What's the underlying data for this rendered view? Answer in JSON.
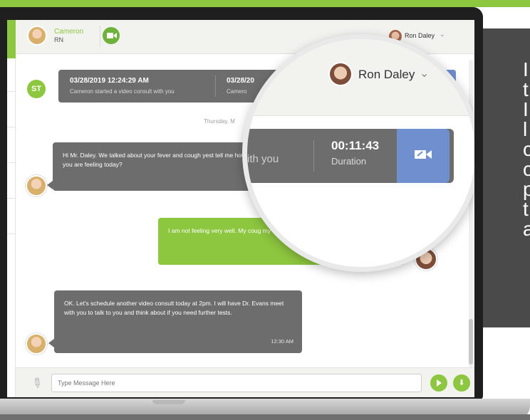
{
  "header": {
    "nurse_name": "Cameron",
    "nurse_role": "RN",
    "patient_name": "Ron Daley",
    "chevron": "⌄"
  },
  "event": {
    "badge": "ST",
    "timestamp": "03/28/2019 12:24:29 AM",
    "description": "Cameron started a video consult with you",
    "timestamp_partial": "03/28/20",
    "description_partial": "Camero"
  },
  "day_label": "Thursday, M",
  "messages": [
    {
      "from": "nurse",
      "text": "Hi Mr. Daley. We talked about your fever and cough yest tell me how you are feeling today?",
      "time": ""
    },
    {
      "from": "patient",
      "text": "I am not feeling very well. My coug my appetite is gone, I have a bit of a n",
      "time": ""
    },
    {
      "from": "nurse",
      "text": "OK. Let's schedule another video consult today at 2pm. I will have Dr. Evans meet with you to talk to you and think about if you need further tests.",
      "time": "12:30 AM"
    }
  ],
  "input": {
    "placeholder": "Type Message Here"
  },
  "magnifier": {
    "patient_name": "Ron Daley",
    "chevron": "⌄",
    "partial_text": "ith you",
    "duration_value": "00:11:43",
    "duration_label": "Duration"
  },
  "promo_lines": [
    "I",
    "t",
    "I",
    "l",
    "c",
    "c",
    "p",
    "t",
    "a"
  ],
  "colors": {
    "accent_green": "#8dc63f",
    "bubble_gray": "#6d6d6d",
    "video_blue": "#6f8fcf",
    "promo_bg": "#4a4a4a"
  },
  "icons": [
    "video-call-icon",
    "paperclip-icon",
    "send-icon",
    "upload-icon",
    "camera-icon",
    "chevron-down-icon"
  ]
}
